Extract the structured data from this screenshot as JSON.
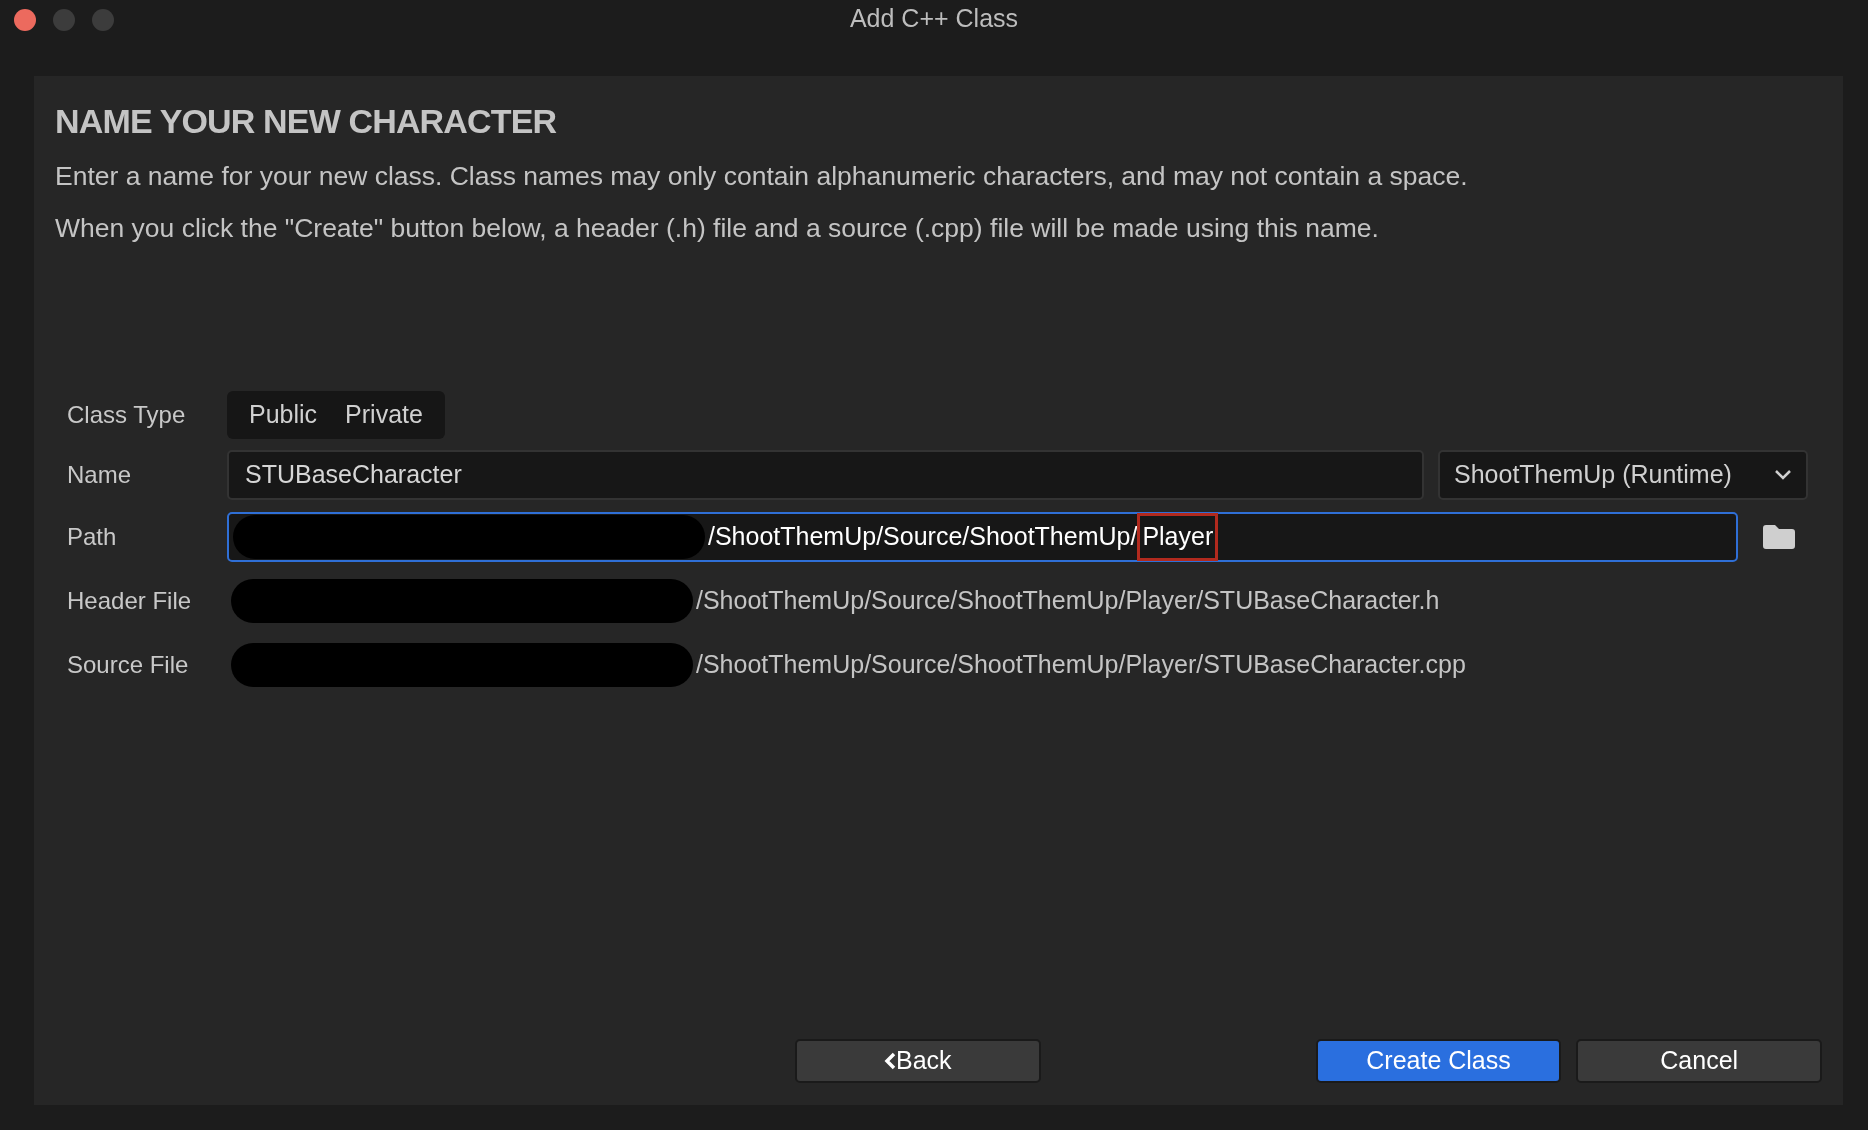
{
  "window": {
    "title": "Add C++ Class"
  },
  "heading": "NAME YOUR NEW CHARACTER",
  "description": [
    "Enter a name for your new class. Class names may only contain alphanumeric characters, and may not contain a space.",
    "When you click the \"Create\" button below, a header (.h) file and a source (.cpp) file will be made using this name."
  ],
  "class_type": {
    "label": "Class Type",
    "options": [
      {
        "label": "Public",
        "selected": false
      },
      {
        "label": "Private",
        "selected": false
      }
    ]
  },
  "name": {
    "label": "Name",
    "value": "STUBaseCharacter",
    "module": "ShootThemUp (Runtime)"
  },
  "path": {
    "label": "Path",
    "redacted": true,
    "value": "/ShootThemUp/Source/ShootThemUp/",
    "highlighted_part": "Player",
    "focused": true
  },
  "files": [
    {
      "label": "Header File",
      "redacted": true,
      "value": "/ShootThemUp/Source/ShootThemUp/Player/STUBaseCharacter.h"
    },
    {
      "label": "Source File",
      "redacted": true,
      "value": "/ShootThemUp/Source/ShootThemUp/Player/STUBaseCharacter.cpp"
    }
  ],
  "buttons": [
    {
      "kind": "back",
      "label": "Back"
    },
    {
      "kind": "primary",
      "label": "Create Class"
    },
    {
      "kind": "secondary",
      "label": "Cancel"
    }
  ]
}
